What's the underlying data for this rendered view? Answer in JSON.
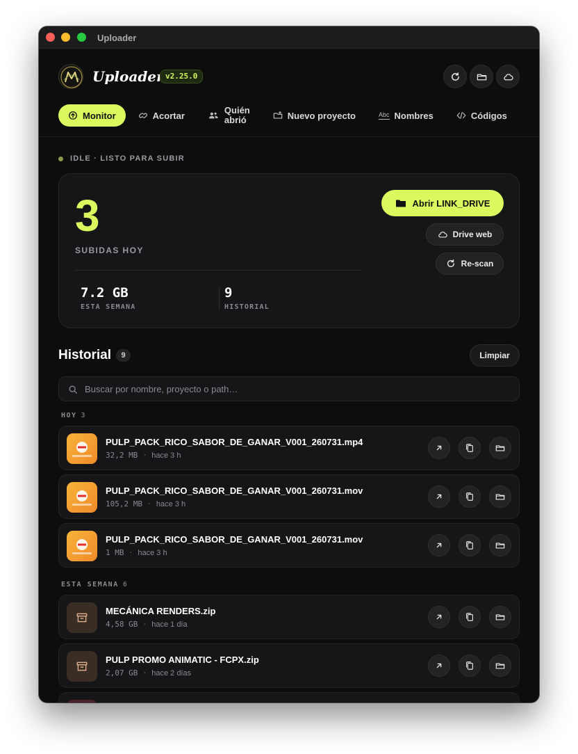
{
  "window": {
    "title": "Uploader"
  },
  "header": {
    "brand": "Uploader.",
    "version": "v2.25.0",
    "actions": [
      {
        "icon": "refresh-icon"
      },
      {
        "icon": "folder-icon"
      },
      {
        "icon": "cloud-icon"
      }
    ]
  },
  "nav": {
    "items": [
      {
        "label": "Monitor",
        "icon": "monitor-icon",
        "active": true
      },
      {
        "label": "Acortar",
        "icon": "link-icon"
      },
      {
        "label_line1": "Quién",
        "label_line2": "abrió",
        "icon": "users-icon"
      },
      {
        "label": "Nuevo proyecto",
        "icon": "folder-plus-icon"
      },
      {
        "label": "Nombres",
        "icon_text": "Abc",
        "icon": "abc-icon"
      },
      {
        "label": "Códigos",
        "icon": "code-icon"
      }
    ]
  },
  "status": {
    "text": "IDLE · LISTO PARA SUBIR"
  },
  "summary": {
    "uploads_today": "3",
    "uploads_today_label": "SUBIDAS HOY",
    "week_value": "7.2 GB",
    "week_label": "ESTA SEMANA",
    "history_value": "9",
    "history_label": "HISTORIAL",
    "open_drive_label": "Abrir LINK_DRIVE",
    "drive_web_label": "Drive web",
    "rescan_label": "Re-scan"
  },
  "history": {
    "title": "Historial",
    "count": "9",
    "clear_label": "Limpiar",
    "search_placeholder": "Buscar por nombre, proyecto o path…",
    "groups": [
      {
        "label": "HOY",
        "count": "3",
        "items": [
          {
            "name": "PULP_PACK_RICO_SABOR_DE_GANAR_V001_260731.mp4",
            "size": "32,2 MB",
            "ago": "hace 3 h",
            "kind": "video"
          },
          {
            "name": "PULP_PACK_RICO_SABOR_DE_GANAR_V001_260731.mov",
            "size": "105,2 MB",
            "ago": "hace 3 h",
            "kind": "video"
          },
          {
            "name": "PULP_PACK_RICO_SABOR_DE_GANAR_V001_260731.mov",
            "size": "1 MB",
            "ago": "hace 3 h",
            "kind": "video"
          }
        ]
      },
      {
        "label": "ESTA SEMANA",
        "count": "6",
        "items": [
          {
            "name": "MECÁNICA RENDERS.zip",
            "size": "4,58 GB",
            "ago": "hace 1 día",
            "kind": "archive"
          },
          {
            "name": "PULP PROMO ANIMATIC - FCPX.zip",
            "size": "2,07 GB",
            "ago": "hace 2 días",
            "kind": "archive"
          }
        ]
      }
    ],
    "row_actions": [
      "open-external-icon",
      "copy-icon",
      "folder-icon"
    ]
  },
  "colors": {
    "accent": "#d9f95e",
    "background": "#0d0d0d",
    "card": "#161618",
    "status_dot": "#8a9a4a",
    "video_thumb": "#f7b43a",
    "archive_thumb": "#3a2d24"
  }
}
